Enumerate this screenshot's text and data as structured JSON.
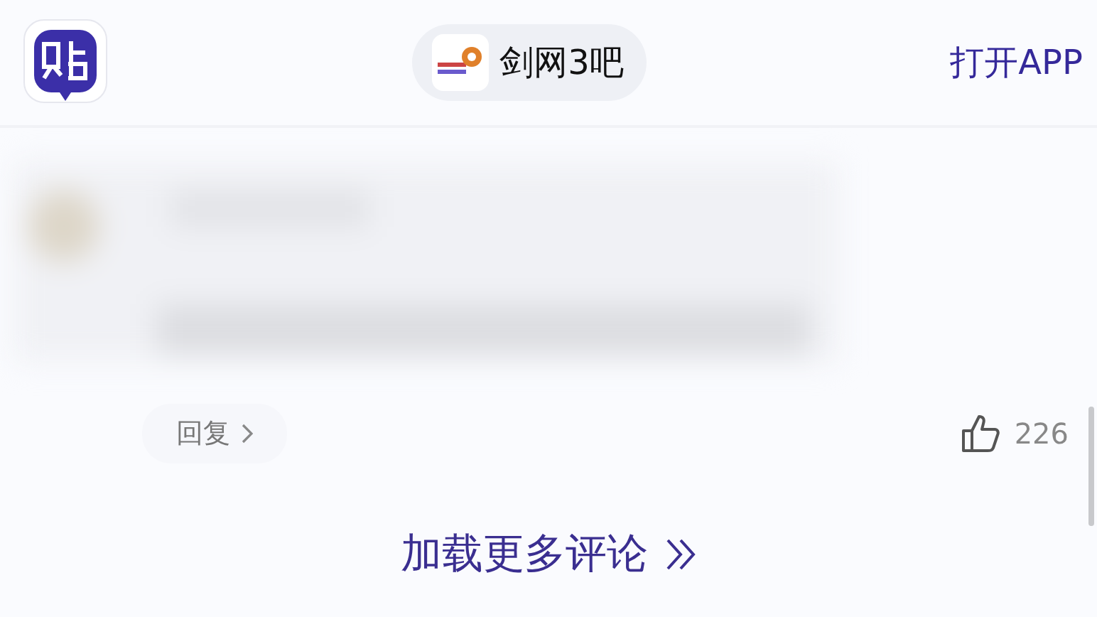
{
  "header": {
    "forum_name": "剑网3吧",
    "open_app": "打开APP"
  },
  "comment": {
    "reply": "回复",
    "likes": "226"
  },
  "load_more": "加载更多评论"
}
